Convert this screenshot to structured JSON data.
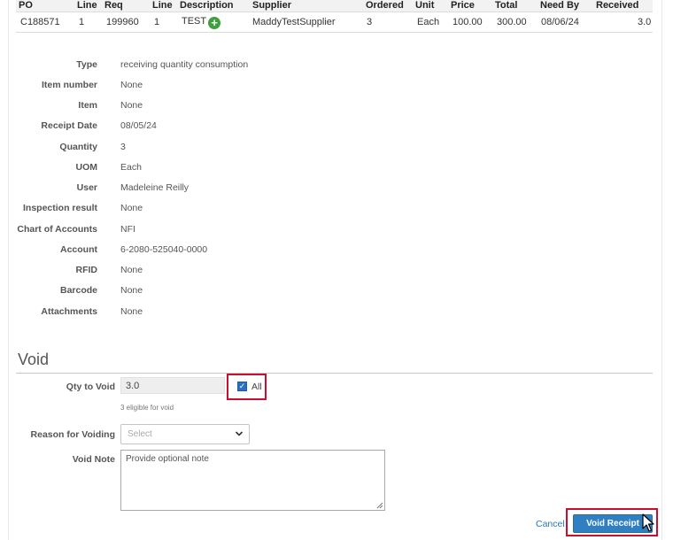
{
  "table": {
    "headers": [
      "PO",
      "Line",
      "Req",
      "Line",
      "Description",
      "Supplier",
      "Ordered",
      "Unit",
      "Price",
      "Total",
      "Need By",
      "Received"
    ],
    "row": {
      "po": "C188571",
      "line": "1",
      "req": "199960",
      "req_line": "1",
      "description": "TEST",
      "supplier": "MaddyTestSupplier",
      "ordered": "3",
      "unit": "Each",
      "price": "100.00",
      "total": "300.00",
      "need_by": "08/06/24",
      "received": "3.0"
    }
  },
  "details": [
    {
      "label": "Type",
      "value": "receiving quantity consumption"
    },
    {
      "label": "Item number",
      "value": "None"
    },
    {
      "label": "Item",
      "value": "None"
    },
    {
      "label": "Receipt Date",
      "value": "08/05/24"
    },
    {
      "label": "Quantity",
      "value": "3"
    },
    {
      "label": "UOM",
      "value": "Each"
    },
    {
      "label": "User",
      "value": "Madeleine Reilly"
    },
    {
      "label": "Inspection result",
      "value": "None"
    },
    {
      "label": "Chart of Accounts",
      "value": "NFI"
    },
    {
      "label": "Account",
      "value": "6-2080-525040-0000"
    },
    {
      "label": "RFID",
      "value": "None"
    },
    {
      "label": "Barcode",
      "value": "None"
    },
    {
      "label": "Attachments",
      "value": "None"
    }
  ],
  "void": {
    "title": "Void",
    "qty_label": "Qty to Void",
    "qty_value": "3.0",
    "all_label": "All",
    "all_checked": true,
    "eligible_text": "3 eligible for void",
    "reason_label": "Reason for Voiding",
    "reason_placeholder": "Select",
    "note_label": "Void Note",
    "note_placeholder": "Provide optional note",
    "cancel_label": "Cancel",
    "void_button_label": "Void Receipt"
  },
  "colors": {
    "link": "#2a7ab8",
    "primary_button": "#2f7fc1",
    "highlight": "#c8102e",
    "add_icon": "#3e9f41"
  },
  "icons": {
    "add": "plus-circle-icon",
    "dropdown": "chevron-down-icon",
    "cursor": "mouse-pointer-icon"
  }
}
